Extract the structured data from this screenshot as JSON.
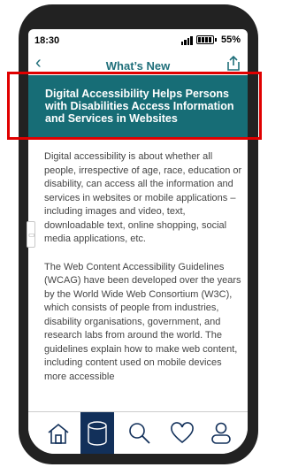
{
  "status_bar": {
    "time": "18:30",
    "battery": "55%"
  },
  "nav": {
    "title": "What’s New",
    "back_icon": "chevron-left-icon",
    "share_icon": "share-icon"
  },
  "banner": {
    "title": "Digital Accessibility Helps Persons with Disabilities Access Information and Services in Websites"
  },
  "article": {
    "paragraphs": [
      "Digital accessibility is about whether all people, irrespective of age, race, education or disability, can access all the information and services in websites or mobile applications – including images and video, text, downloadable text, online shopping, social media applications, etc.",
      "The Web Content Accessibility Guidelines (WCAG) have been developed over the years by the World Wide Web Consortium (W3C), which consists of people from industries, disability organisations, government, and research labs from around the world. The guidelines explain how to make web content, including content used on mobile devices more accessible"
    ]
  },
  "tab_bar": {
    "tabs": [
      {
        "icon": "home-icon",
        "active": false
      },
      {
        "icon": "database-icon",
        "active": true
      },
      {
        "icon": "search-icon",
        "active": false
      },
      {
        "icon": "heart-icon",
        "active": false
      },
      {
        "icon": "user-icon",
        "active": false
      }
    ]
  },
  "colors": {
    "accent": "#176d76",
    "active_tab": "#12305a",
    "highlight": "#e00000"
  }
}
